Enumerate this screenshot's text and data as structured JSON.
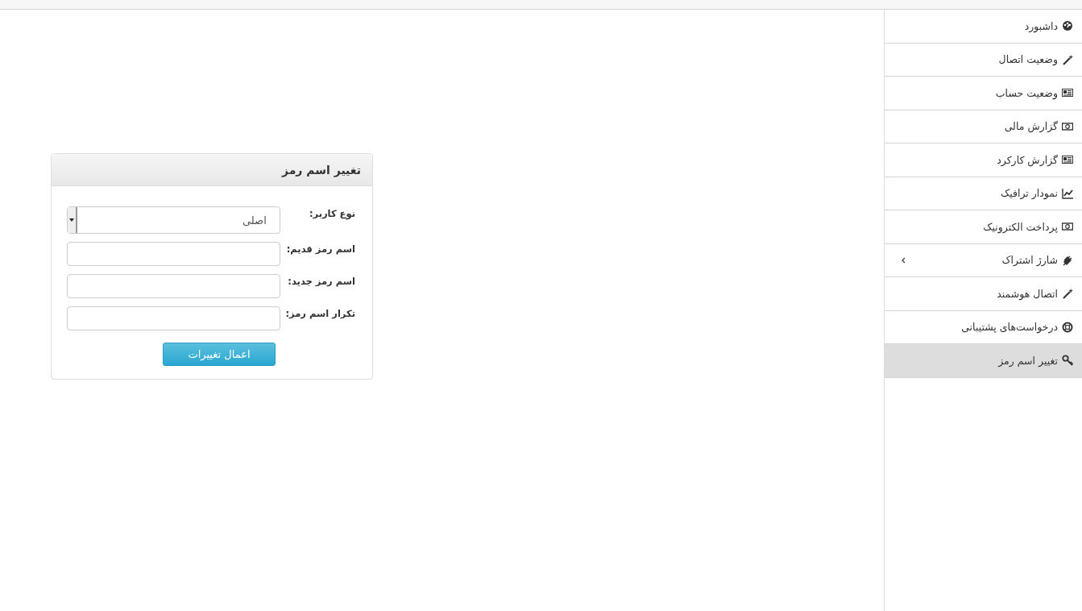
{
  "panel": {
    "title": "تغییر اسم رمز",
    "fields": [
      {
        "kind": "select",
        "label": "نوع کاربر:",
        "value": "اصلی"
      },
      {
        "kind": "password",
        "label": "اسم رمز قدیم:"
      },
      {
        "kind": "password",
        "label": "اسم رمز جدید:"
      },
      {
        "kind": "password",
        "label": "تکرار اسم رمز:"
      }
    ],
    "submit": "اعمال تغییرات"
  },
  "sidebar": {
    "items": [
      {
        "label": "داشبورد",
        "kind": "gauge",
        "selected": false,
        "has_submenu": false
      },
      {
        "label": "وضعیت اتصال",
        "kind": "wand",
        "selected": false,
        "has_submenu": false
      },
      {
        "label": "وضعیت حساب",
        "kind": "newspaper",
        "selected": false,
        "has_submenu": false
      },
      {
        "label": "گزارش مالی",
        "kind": "money",
        "selected": false,
        "has_submenu": false
      },
      {
        "label": "گزارش کارکرد",
        "kind": "newspaper",
        "selected": false,
        "has_submenu": false
      },
      {
        "label": "نمودار ترافیک",
        "kind": "chart",
        "selected": false,
        "has_submenu": false
      },
      {
        "label": "پرداخت الکترونیک",
        "kind": "money",
        "selected": false,
        "has_submenu": false
      },
      {
        "label": "شارژ اشتراک",
        "kind": "plug",
        "selected": false,
        "has_submenu": true
      },
      {
        "label": "اتصال هوشمند",
        "kind": "wand",
        "selected": false,
        "has_submenu": false
      },
      {
        "label": "درخواست‌های پشتیبانی",
        "kind": "lifebuoy",
        "selected": false,
        "has_submenu": false
      },
      {
        "label": "تغییر اسم رمز",
        "kind": "key",
        "selected": true,
        "has_submenu": false
      }
    ]
  }
}
